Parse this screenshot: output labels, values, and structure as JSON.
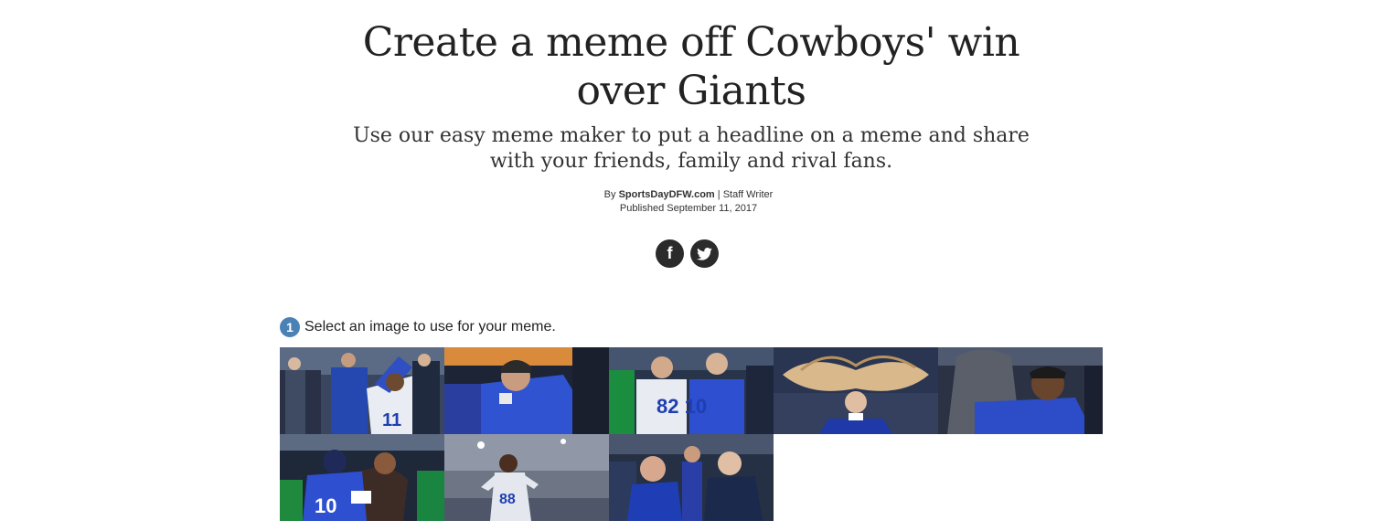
{
  "article": {
    "headline": "Create a meme off Cowboys' win over Giants",
    "dek": "Use our easy meme maker to put a headline on a meme and share with your friends, family and rival fans.",
    "byline_prefix": "By",
    "author": "SportsDayDFW.com",
    "byline_separator": "|",
    "author_role": "Staff Writer",
    "published": "Published September 11, 2017"
  },
  "share": {
    "facebook_glyph": "f",
    "facebook_icon": "facebook-icon",
    "twitter_icon": "twitter-icon"
  },
  "meme_maker": {
    "step_number": "1",
    "step_label": "Select an image to use for your meme.",
    "images": [
      {
        "id": "thumb-1",
        "jersey": "11"
      },
      {
        "id": "thumb-2",
        "jersey": ""
      },
      {
        "id": "thumb-3",
        "jersey": "82  10"
      },
      {
        "id": "thumb-4",
        "jersey": ""
      },
      {
        "id": "thumb-5",
        "jersey": ""
      },
      {
        "id": "thumb-6",
        "jersey": "10"
      },
      {
        "id": "thumb-7",
        "jersey": "88"
      },
      {
        "id": "thumb-8",
        "jersey": ""
      }
    ]
  },
  "colors": {
    "text": "#222222",
    "step_badge": "#4a82b6",
    "social_button": "#2b2b2b",
    "giants_blue": "#1f3fb0",
    "cowboys_white": "#e8ecf2"
  }
}
